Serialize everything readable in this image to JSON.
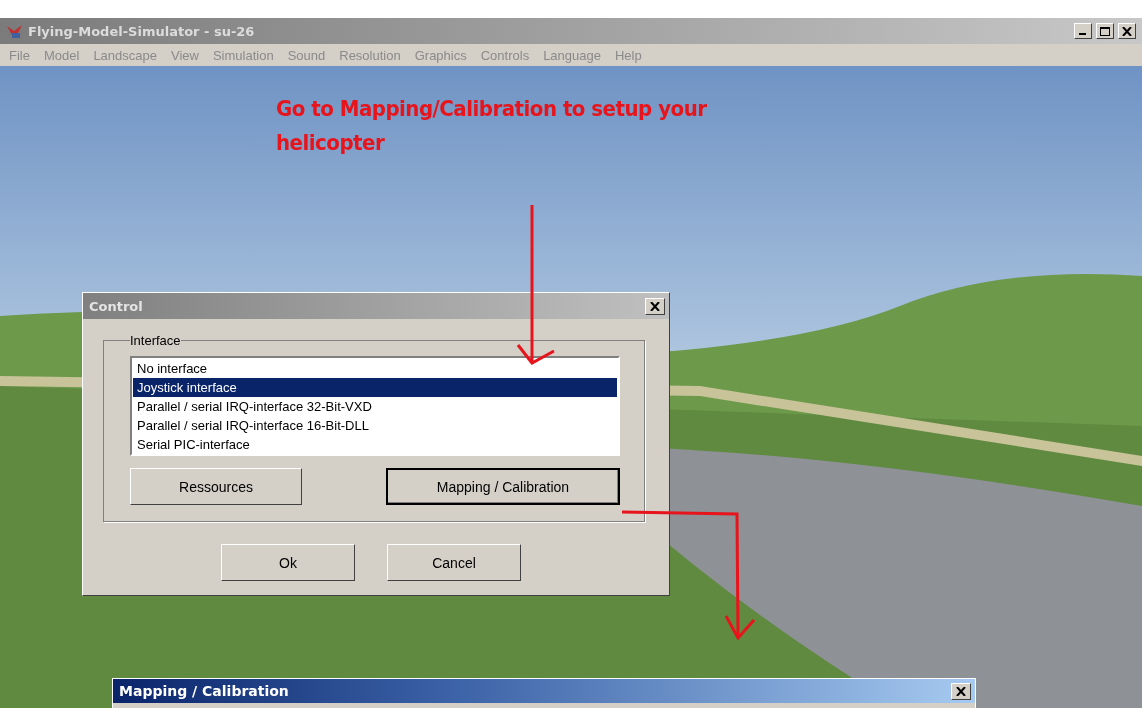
{
  "window": {
    "title": "Flying-Model-Simulator - su-26"
  },
  "menu": [
    "File",
    "Model",
    "Landscape",
    "View",
    "Simulation",
    "Sound",
    "Resolution",
    "Graphics",
    "Controls",
    "Language",
    "Help"
  ],
  "annotation": {
    "text": "Go to Mapping/Calibration to setup your helicopter"
  },
  "control_dialog": {
    "title": "Control",
    "group_label": "Interface",
    "interfaces": [
      {
        "label": "No interface",
        "selected": false
      },
      {
        "label": "Joystick interface",
        "selected": true
      },
      {
        "label": "Parallel / serial IRQ-interface 32-Bit-VXD",
        "selected": false
      },
      {
        "label": "Parallel / serial IRQ-interface 16-Bit-DLL",
        "selected": false
      },
      {
        "label": "Serial PIC-interface",
        "selected": false
      }
    ],
    "group_buttons": [
      {
        "label": "Ressources",
        "default": false
      },
      {
        "label": "Mapping / Calibration",
        "default": true
      }
    ],
    "buttons": [
      {
        "label": "Ok",
        "default": false
      },
      {
        "label": "Cancel",
        "default": false
      }
    ]
  },
  "mapping_window": {
    "title": "Mapping / Calibration"
  }
}
